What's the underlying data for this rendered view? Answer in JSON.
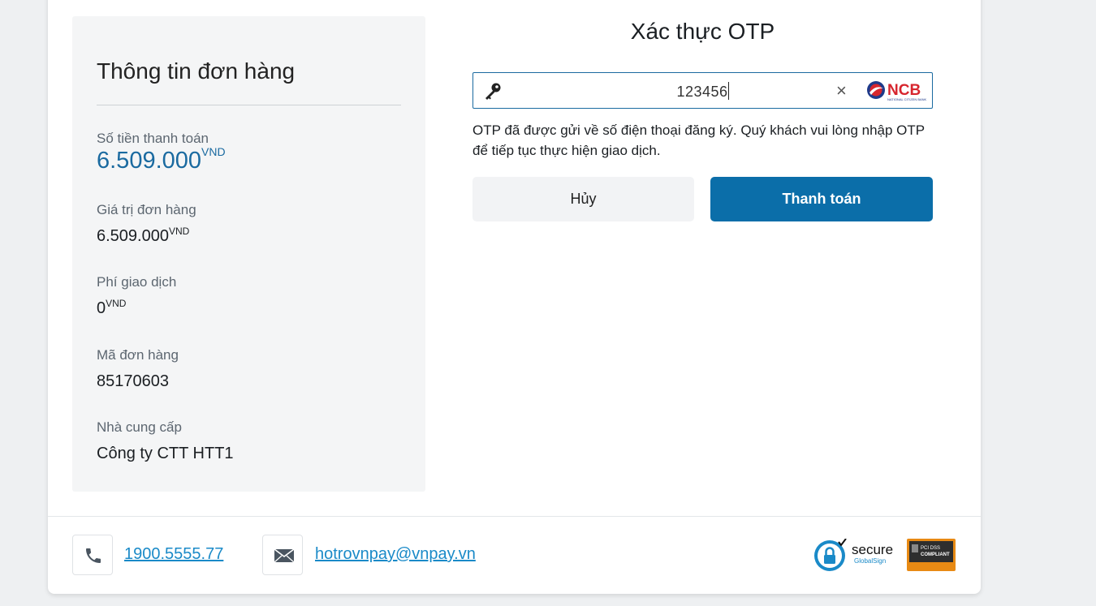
{
  "order": {
    "title": "Thông tin đơn hàng",
    "fields": [
      {
        "label": "Số tiền thanh toán",
        "value": "6.509.000",
        "unit": "VND"
      },
      {
        "label": "Giá trị đơn hàng",
        "value": "6.509.000",
        "unit": "VND"
      },
      {
        "label": "Phí giao dịch",
        "value": "0",
        "unit": "VND"
      },
      {
        "label": "Mã đơn hàng",
        "value": "85170603"
      },
      {
        "label": "Nhà cung cấp",
        "value": "Công ty CTT HTT1"
      }
    ]
  },
  "otp": {
    "title": "Xác thực OTP",
    "input_value": "123456",
    "clear_glyph": "×",
    "bank_logo_text": "NCB",
    "bank_logo_subtext": "NATIONAL CITIZEN BANK",
    "note": "OTP đã được gửi về số điện thoại đăng ký. Quý khách vui lòng nhập OTP để tiếp tục thực hiện giao dịch.",
    "cancel_label": "Hủy",
    "pay_label": "Thanh toán"
  },
  "footer": {
    "phone": "1900.5555.77",
    "email": "hotrovnpay@vnpay.vn",
    "secure_badge": {
      "line1": "secure",
      "line2": "GlobalSign"
    },
    "pci_badge": {
      "line1": "PCI DSS",
      "line2": "COMPLIANT"
    }
  },
  "colors": {
    "accent": "#0b6ea9",
    "amount": "#1a6aa0",
    "link": "#1a8ac8",
    "panel": "#f4f5f6"
  }
}
